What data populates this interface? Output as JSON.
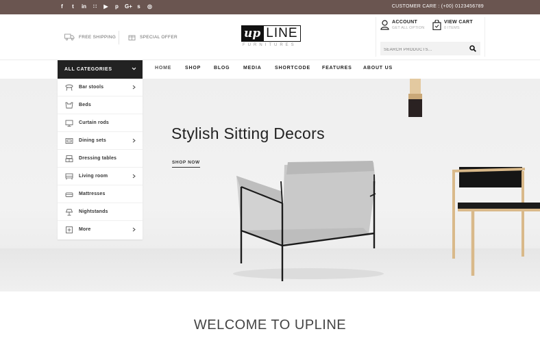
{
  "topbar": {
    "social": [
      {
        "icon": "facebook-icon",
        "glyph": "f"
      },
      {
        "icon": "twitter-icon",
        "glyph": "t"
      },
      {
        "icon": "linkedin-icon",
        "glyph": "in"
      },
      {
        "icon": "rss-icon",
        "glyph": "∷"
      },
      {
        "icon": "youtube-icon",
        "glyph": "▶"
      },
      {
        "icon": "pinterest-icon",
        "glyph": "p"
      },
      {
        "icon": "google-plus-icon",
        "glyph": "G+"
      },
      {
        "icon": "skype-icon",
        "glyph": "s"
      },
      {
        "icon": "instagram-icon",
        "glyph": "◎"
      }
    ],
    "customer_care": "CUSTOMER CARE : (+00) 0123456789"
  },
  "header": {
    "free_shipping": "FREE SHIPPING",
    "special_offer": "SPECIAL OFFER",
    "logo_up": "up",
    "logo_line": "LINE",
    "logo_sub": "FURNITURES",
    "account_title": "ACCOUNT",
    "account_sub": "GET ALL OPTION",
    "cart_title": "VIEW CART",
    "cart_sub": "0 ITEMS",
    "search_placeholder": "SEARCH PRODUCTS..."
  },
  "nav": {
    "all_categories": "ALL CATEGORIES",
    "menu": [
      "HOME",
      "SHOP",
      "BLOG",
      "MEDIA",
      "SHORTCODE",
      "FEATURES",
      "ABOUT US"
    ]
  },
  "categories": [
    {
      "label": "Bar stools",
      "icon": "bar-stool-icon",
      "has_sub": true
    },
    {
      "label": "Beds",
      "icon": "bed-icon",
      "has_sub": false
    },
    {
      "label": "Curtain rods",
      "icon": "curtain-icon",
      "has_sub": false
    },
    {
      "label": "Dining sets",
      "icon": "dining-icon",
      "has_sub": true
    },
    {
      "label": "Dressing tables",
      "icon": "dressing-table-icon",
      "has_sub": false
    },
    {
      "label": "Living room",
      "icon": "sofa-icon",
      "has_sub": true
    },
    {
      "label": "Mattresses",
      "icon": "mattress-icon",
      "has_sub": false
    },
    {
      "label": "Nightstands",
      "icon": "lamp-icon",
      "has_sub": false
    },
    {
      "label": "More",
      "icon": "plus-box-icon",
      "has_sub": true
    }
  ],
  "hero": {
    "title": "Stylish Sitting Decors",
    "cta": "SHOP NOW"
  },
  "welcome": "WELCOME TO UPLINE",
  "colors": {
    "topbar": "#6a5550",
    "dark": "#222222",
    "accent_wood": "#d9b98a"
  }
}
